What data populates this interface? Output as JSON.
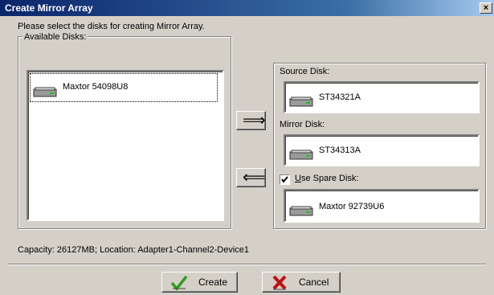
{
  "window": {
    "title": "Create Mirror Array",
    "close_label": "×"
  },
  "instruction": "Please select the disks for creating Mirror Array.",
  "available": {
    "legend": "Available Disks:",
    "items": [
      {
        "label": "Maxtor 54098U8",
        "icon": "hard-disk-icon"
      }
    ]
  },
  "move_right_label": "⟹",
  "move_left_label": "⟸",
  "source": {
    "label": "Source Disk:",
    "disk": "ST34321A"
  },
  "mirror": {
    "label": "Mirror Disk:",
    "disk": "ST34313A"
  },
  "spare": {
    "label_underlined": "U",
    "label_rest": "se Spare Disk:",
    "checked": true,
    "disk": "Maxtor 92739U6"
  },
  "info": "Capacity: 26127MB; Location: Adapter1-Channel2-Device1",
  "buttons": {
    "create": "Create",
    "cancel": "Cancel"
  },
  "colors": {
    "titlebar_start": "#0a246a",
    "titlebar_end": "#a6caf0",
    "face": "#d4d0c8",
    "create_check": "#2e9e1e",
    "cancel_x": "#c01010"
  }
}
